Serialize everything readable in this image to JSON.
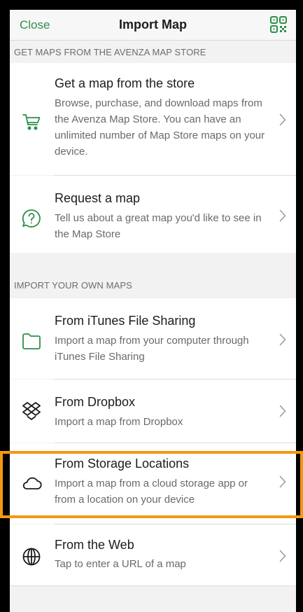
{
  "nav": {
    "close_label": "Close",
    "title": "Import Map",
    "qr_icon": "qr-code-icon"
  },
  "sections": {
    "store_header": "GET MAPS FROM THE AVENZA MAP STORE",
    "own_header": "IMPORT YOUR OWN MAPS"
  },
  "rows": {
    "store": {
      "title": "Get a map from the store",
      "desc": "Browse, purchase, and download maps from the Avenza Map Store. You can have an unlimited number of Map Store maps on your device.",
      "icon": "cart-icon"
    },
    "request": {
      "title": "Request a map",
      "desc": "Tell us about a great map you'd like to see in the Map Store",
      "icon": "help-chat-icon"
    },
    "itunes": {
      "title": "From iTunes File Sharing",
      "desc": "Import a map from your computer through iTunes File Sharing",
      "icon": "folder-icon"
    },
    "dropbox": {
      "title": "From Dropbox",
      "desc": "Import a map from Dropbox",
      "icon": "dropbox-icon"
    },
    "storage": {
      "title": "From Storage Locations",
      "desc": "Import a map from a cloud storage app or from a location on your device",
      "icon": "cloud-icon"
    },
    "web": {
      "title": "From the Web",
      "desc": "Tap to enter a URL of a map",
      "icon": "globe-icon"
    }
  },
  "colors": {
    "accent": "#2f8f4a",
    "highlight": "#f5970f"
  }
}
